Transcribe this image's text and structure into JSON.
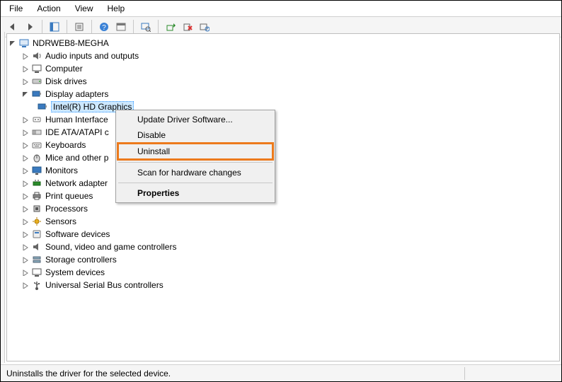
{
  "menu": {
    "file": "File",
    "action": "Action",
    "view": "View",
    "help": "Help"
  },
  "tree": {
    "root": "NDRWEB8-MEGHA",
    "audio": "Audio inputs and outputs",
    "computer": "Computer",
    "disk": "Disk drives",
    "display": "Display adapters",
    "display_child": "Intel(R) HD Graphics",
    "hid": "Human Interface",
    "ide": "IDE ATA/ATAPI c",
    "keyboards": "Keyboards",
    "mice": "Mice and other p",
    "monitors": "Monitors",
    "network": "Network adapter",
    "printq": "Print queues",
    "processors": "Processors",
    "sensors": "Sensors",
    "software": "Software devices",
    "sound": "Sound, video and game controllers",
    "storage": "Storage controllers",
    "system": "System devices",
    "usb": "Universal Serial Bus controllers"
  },
  "ctx": {
    "update": "Update Driver Software...",
    "disable": "Disable",
    "uninstall": "Uninstall",
    "scan": "Scan for hardware changes",
    "properties": "Properties"
  },
  "status": "Uninstalls the driver for the selected device."
}
